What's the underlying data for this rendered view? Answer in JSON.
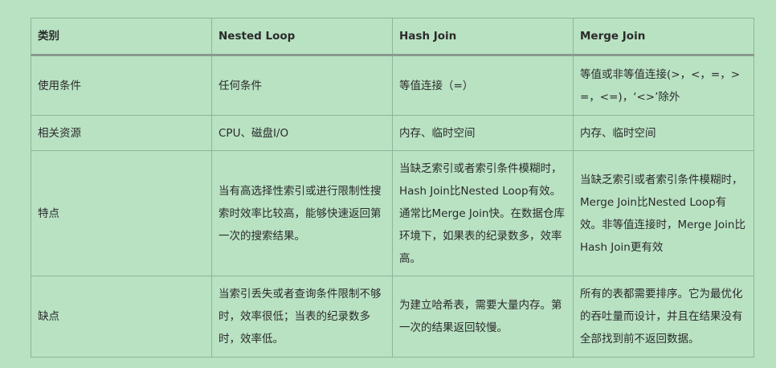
{
  "table": {
    "headers": [
      "类别",
      "Nested Loop",
      "Hash Join",
      "Merge Join"
    ],
    "rows": [
      [
        "使用条件",
        "任何条件",
        "等值连接（=）",
        "等值或非等值连接(>，<，=，>=，<=)，‘<>’除外"
      ],
      [
        "相关资源",
        "CPU、磁盘I/O",
        "内存、临时空间",
        "内存、临时空间"
      ],
      [
        "特点",
        "当有高选择性索引或进行限制性搜索时效率比较高，能够快速返回第一次的搜索结果。",
        "当缺乏索引或者索引条件模糊时，Hash Join比Nested Loop有效。通常比Merge Join快。在数据仓库环境下，如果表的纪录数多，效率高。",
        "当缺乏索引或者索引条件模糊时，Merge Join比Nested Loop有效。非等值连接时，Merge Join比Hash Join更有效"
      ],
      [
        "缺点",
        "当索引丢失或者查询条件限制不够时，效率很低；当表的纪录数多时，效率低。",
        "为建立哈希表，需要大量内存。第一次的结果返回较慢。",
        "所有的表都需要排序。它为最优化的吞吐量而设计，并且在结果没有全部找到前不返回数据。"
      ]
    ]
  }
}
